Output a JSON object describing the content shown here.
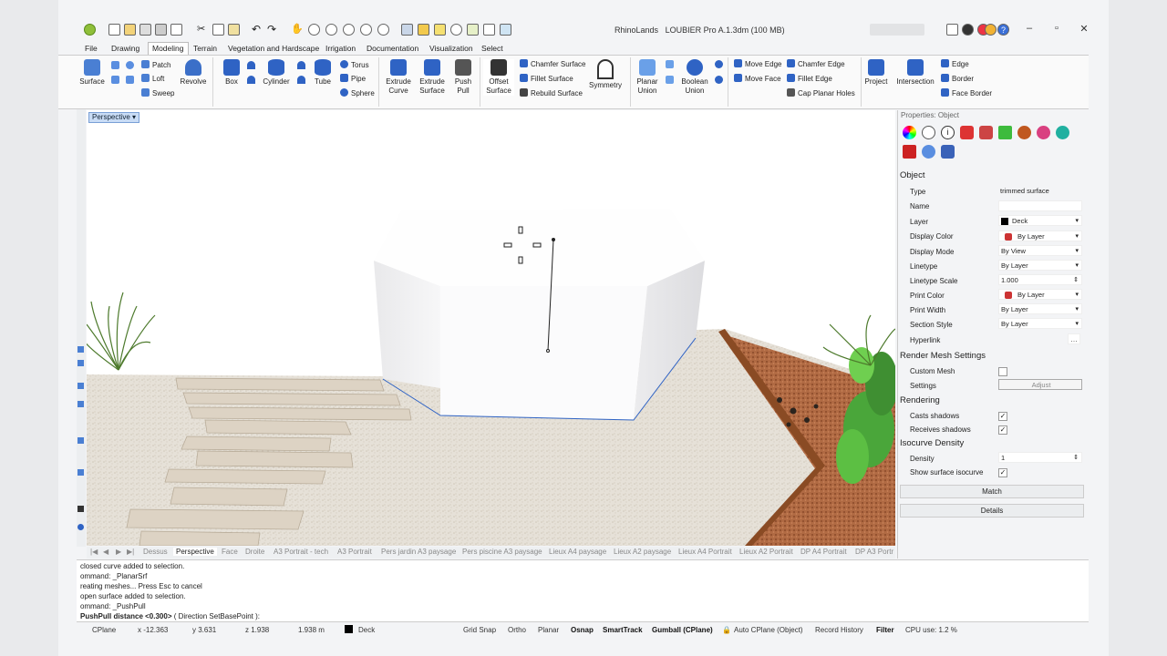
{
  "title": {
    "app": "RhinoLands",
    "file": "LOUBIER Pro A.1.3dm (100 MB)"
  },
  "menu": [
    "File",
    "Drawing",
    "Modeling",
    "Terrain",
    "Vegetation and Hardscape",
    "Irrigation",
    "Documentation",
    "Visualization",
    "Select"
  ],
  "menu_active": "Modeling",
  "ribbon": {
    "surface": "Surface",
    "patch": "Patch",
    "loft": "Loft",
    "sweep": "Sweep",
    "revolve": "Revolve",
    "box": "Box",
    "cylinder": "Cylinder",
    "tube": "Tube",
    "torus": "Torus",
    "pipe": "Pipe",
    "sphere": "Sphere",
    "extrude_curve": [
      "Extrude",
      "Curve"
    ],
    "extrude_surface": [
      "Extrude",
      "Surface"
    ],
    "push_pull": [
      "Push",
      "Pull"
    ],
    "offset_surface": [
      "Offset",
      "Surface"
    ],
    "chamfer_surface": "Chamfer Surface",
    "fillet_surface": "Fillet Surface",
    "rebuild_surface": "Rebuild Surface",
    "symmetry": "Symmetry",
    "planar_union": [
      "Planar",
      "Union"
    ],
    "boolean_union": [
      "Boolean",
      "Union"
    ],
    "move_edge": "Move Edge",
    "move_face": "Move Face",
    "chamfer_edge": "Chamfer Edge",
    "fillet_edge": "Fillet Edge",
    "cap_planar_holes": "Cap Planar Holes",
    "project": "Project",
    "intersection": "Intersection",
    "edge": "Edge",
    "border": "Border",
    "face_border": "Face Border"
  },
  "viewport": {
    "label": "Perspective"
  },
  "view_tabs": [
    "Dessus",
    "Perspective",
    "Face",
    "Droite",
    "A3 Portrait - tech",
    "A3 Portrait",
    "Pers jardin A3 paysage",
    "Pers piscine A3 paysage",
    "Lieux A4 paysage",
    "Lieux A2 paysage",
    "Lieux A4 Portrait",
    "Lieux A2 Portrait",
    "DP A4 Portrait",
    "DP A3 Portr"
  ],
  "view_tab_active": "Perspective",
  "command_history": [
    "closed curve added to selection.",
    "ommand: _PlanarSrf",
    "reating meshes... Press Esc to cancel",
    "open surface added to selection.",
    "ommand: _PushPull"
  ],
  "command_prompt": {
    "main": "PushPull distance <0.300>",
    "options": "( Direction  SetBasePoint ):"
  },
  "status": {
    "cplane": "CPlane",
    "x": "x -12.363",
    "y": "y 3.631",
    "z": "z 1.938",
    "dist": "1.938 m",
    "layer": "Deck",
    "grid_snap": "Grid Snap",
    "ortho": "Ortho",
    "planar": "Planar",
    "osnap": "Osnap",
    "smarttrack": "SmartTrack",
    "gumball": "Gumball (CPlane)",
    "auto_cplane": "Auto CPlane (Object)",
    "record_history": "Record History",
    "filter": "Filter",
    "cpu": "CPU use: 1.2 %"
  },
  "properties": {
    "header": "Properties: Object",
    "object_section": "Object",
    "rows": [
      {
        "label": "Type",
        "value": "trimmed surface"
      },
      {
        "label": "Name",
        "value": ""
      },
      {
        "label": "Layer",
        "value": "Deck"
      },
      {
        "label": "Display Color",
        "value": "By Layer"
      },
      {
        "label": "Display Mode",
        "value": "By View"
      },
      {
        "label": "Linetype",
        "value": "By Layer"
      },
      {
        "label": "Linetype Scale",
        "value": "1.000"
      },
      {
        "label": "Print Color",
        "value": "By Layer"
      },
      {
        "label": "Print Width",
        "value": "By Layer"
      },
      {
        "label": "Section Style",
        "value": "By Layer"
      },
      {
        "label": "Hyperlink",
        "value": ""
      }
    ],
    "render_mesh_section": "Render Mesh Settings",
    "custom_mesh": "Custom Mesh",
    "settings": "Settings",
    "adjust": "Adjust",
    "rendering_section": "Rendering",
    "casts_shadows": "Casts shadows",
    "receives_shadows": "Receives shadows",
    "isocurve_section": "Isocurve Density",
    "density": "Density",
    "density_value": "1",
    "show_isocurve": "Show surface isocurve",
    "match": "Match",
    "details": "Details"
  }
}
